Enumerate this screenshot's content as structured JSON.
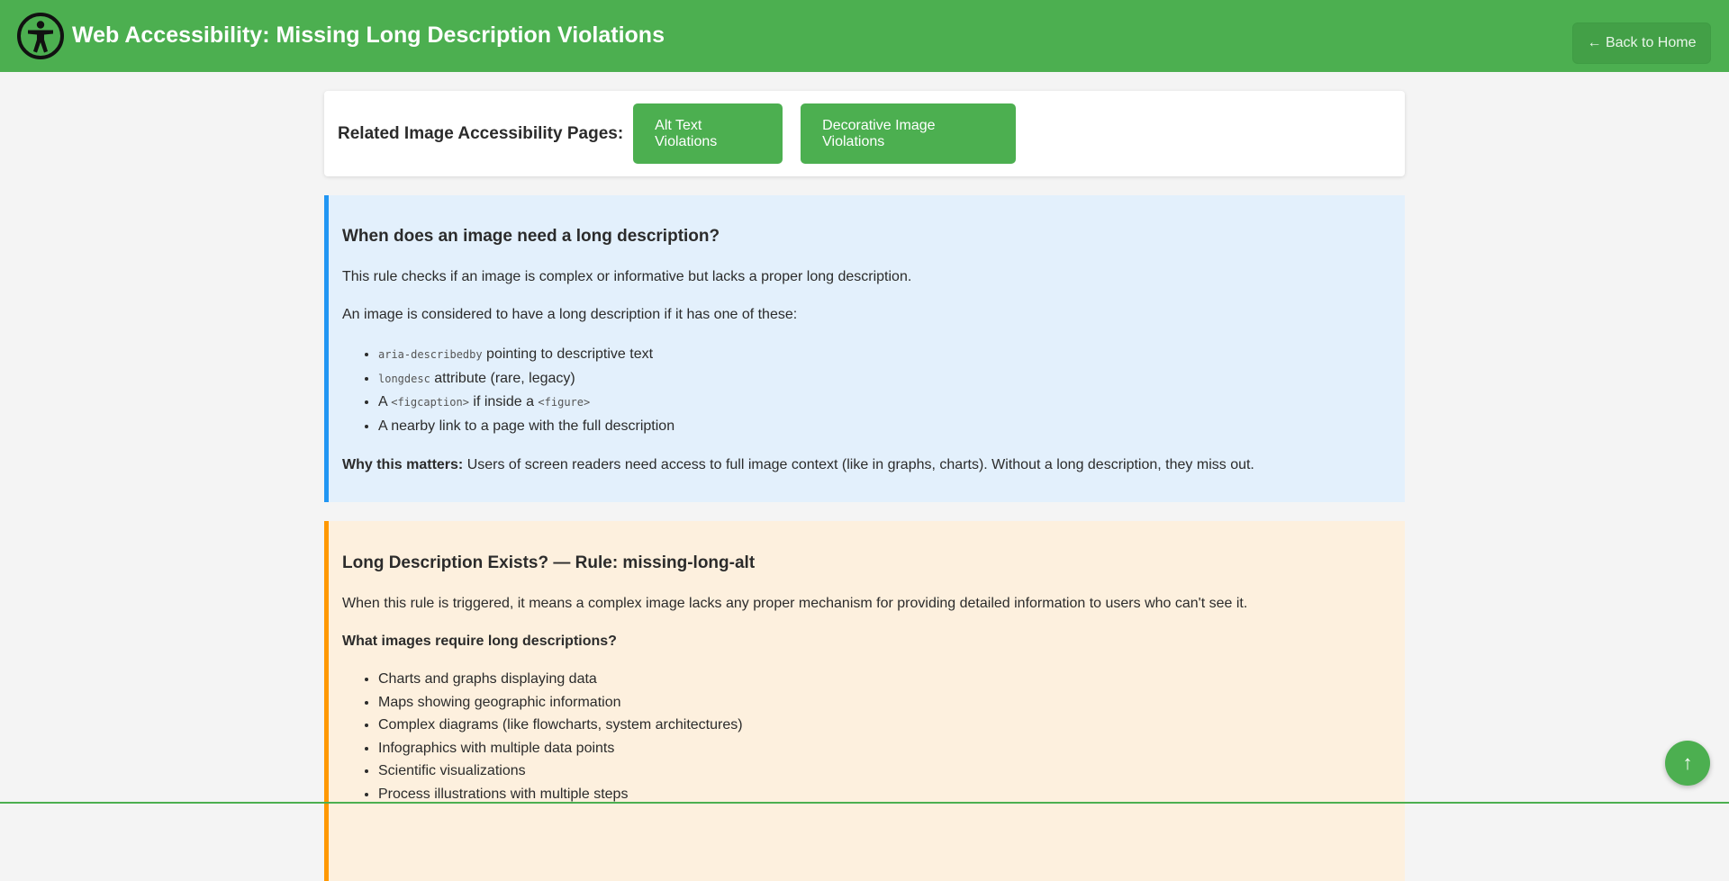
{
  "header": {
    "title": "Web Accessibility: Missing Long Description Violations",
    "logo_icon": "accessibility-person-icon",
    "back_label": "← Back to Home"
  },
  "related": {
    "label": "Related Image Accessibility Pages:",
    "links": [
      "Alt Text Violations",
      "Decorative Image Violations"
    ]
  },
  "info_box": {
    "heading": "When does an image need a long description?",
    "para1": "This rule checks if an image is complex or informative but lacks a proper long description.",
    "para2": "An image is considered to have a long description if it has one of these:",
    "items": [
      {
        "code": "aria-describedby",
        "text": " pointing to descriptive text"
      },
      {
        "code": "longdesc",
        "text": " attribute (rare, legacy)"
      },
      {
        "pre": "A ",
        "code": "<figcaption>",
        "mid": " if inside a ",
        "code2": "<figure>"
      },
      {
        "text": "A nearby link to a page with the full description"
      }
    ],
    "why_label": "Why this matters:",
    "why_text": " Users of screen readers need access to full image context (like in graphs, charts). Without a long description, they miss out."
  },
  "rule_box": {
    "heading": "Long Description Exists? — Rule: missing-long-alt",
    "para": "When this rule is triggered, it means a complex image lacks any proper mechanism for providing detailed information to users who can't see it.",
    "subhead": "What images require long descriptions?",
    "items": [
      "Charts and graphs displaying data",
      "Maps showing geographic information",
      "Complex diagrams (like flowcharts, system architectures)",
      "Infographics with multiple data points",
      "Scientific visualizations",
      "Process illustrations with multiple steps"
    ]
  },
  "scroll_top": {
    "label": "↑",
    "icon": "arrow-up-icon"
  },
  "colors": {
    "brand_green": "#4caf50",
    "info_blue": "#2196f3",
    "warning_orange": "#ff9800"
  }
}
